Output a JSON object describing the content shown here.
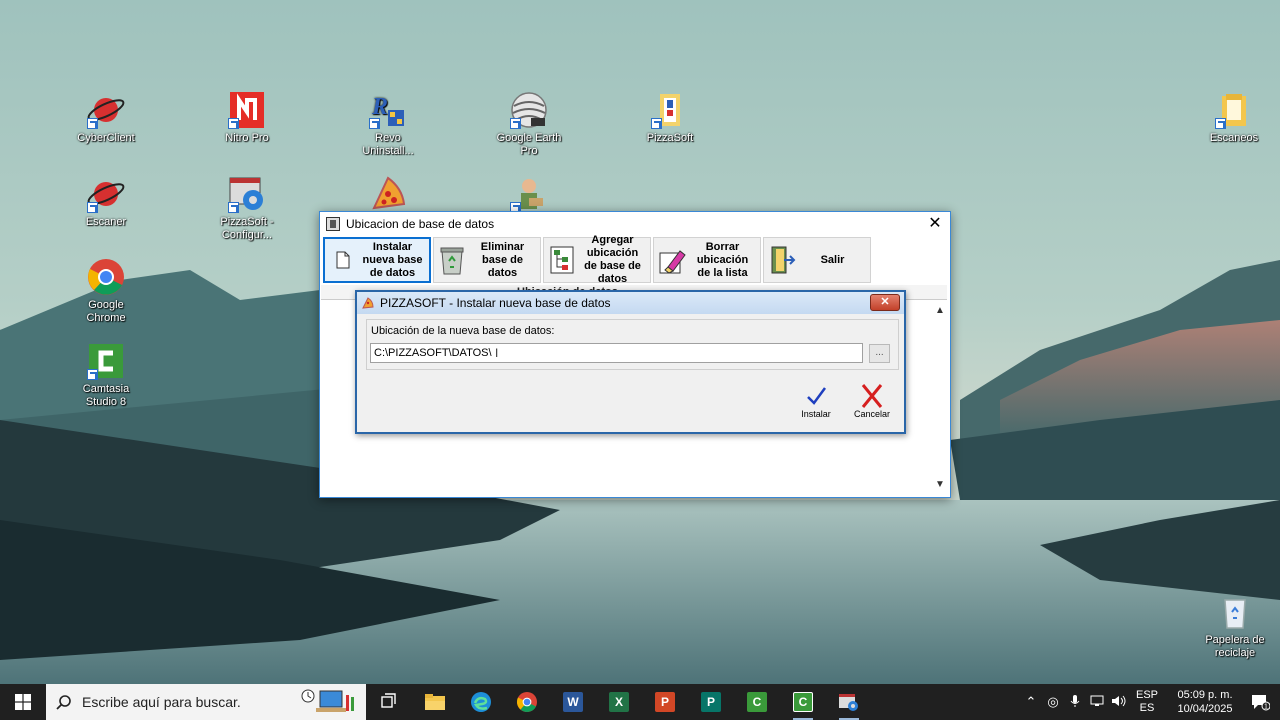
{
  "desktop": {
    "icons": [
      {
        "label": "CyberClient"
      },
      {
        "label": "Nitro Pro"
      },
      {
        "label": "Revo Uninstall..."
      },
      {
        "label": "Google Earth Pro"
      },
      {
        "label": "PizzaSoft"
      },
      {
        "label": "Escaneos"
      },
      {
        "label": "Escaner"
      },
      {
        "label": "PizzaSoft - Configur..."
      },
      {
        "label": "Google Chrome"
      },
      {
        "label": "Camtasia Studio 8"
      },
      {
        "label": "Papelera de reciclaje"
      }
    ]
  },
  "outer_window": {
    "title": "Ubicacion de base de datos",
    "toolbar": {
      "install_new": "Instalar nueva base de datos",
      "delete": "Eliminar base de datos",
      "add_location": "Agregar ubicación de base de datos",
      "remove_location": "Borrar ubicación de la lista",
      "exit": "Salir"
    },
    "list_header": "Ubicación de datos"
  },
  "dialog": {
    "title": "PIZZASOFT - Instalar nueva base de datos",
    "field_label": "Ubicación de la nueva base de datos:",
    "path_value": "C:\\PIZZASOFT\\DATOS\\",
    "browse_label": "...",
    "install_label": "Instalar",
    "cancel_label": "Cancelar"
  },
  "taskbar": {
    "search_placeholder": "Escribe aquí para buscar.",
    "language_top": "ESP",
    "language_bottom": "ES",
    "time": "05:09 p. m.",
    "date": "10/04/2025",
    "notification_count": "1"
  },
  "colors": {
    "accent": "#0a6fd1",
    "taskbar": "#202020",
    "dialog_border": "#2a66a8"
  }
}
